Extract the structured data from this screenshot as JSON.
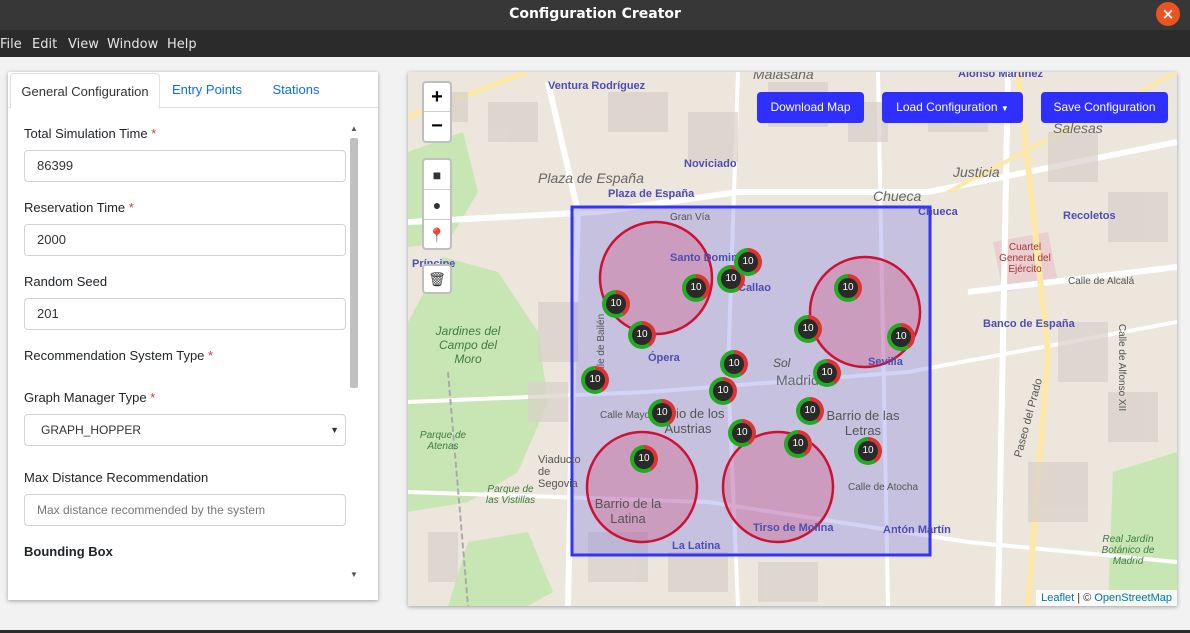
{
  "window": {
    "title": "Configuration Creator",
    "close_icon": "close-icon"
  },
  "menu": [
    "File",
    "Edit",
    "View",
    "Window",
    "Help"
  ],
  "tabs": [
    "General Configuration",
    "Entry Points",
    "Stations"
  ],
  "form": {
    "total_simulation_time": {
      "label": "Total Simulation Time",
      "required": "*",
      "value": "86399"
    },
    "reservation_time": {
      "label": "Reservation Time",
      "required": "*",
      "value": "2000"
    },
    "random_seed": {
      "label": "Random Seed",
      "value": "201"
    },
    "recommendation_system_type": {
      "label": "Recommendation System Type",
      "required": "*"
    },
    "graph_manager_type": {
      "label": "Graph Manager Type",
      "required": "*",
      "value": "GRAPH_HOPPER"
    },
    "max_distance_recommendation": {
      "label": "Max Distance Recommendation",
      "placeholder": "Max distance recommended by the system"
    },
    "bounding_box": {
      "label": "Bounding Box"
    }
  },
  "map": {
    "zoom_in": "+",
    "zoom_out": "−",
    "buttons": {
      "download": "Download Map",
      "load": "Load Configuration",
      "save": "Save Configuration"
    },
    "attribution_leaflet": "Leaflet",
    "attribution_sep": " | © ",
    "attribution_osm": "OpenStreetMap",
    "cluster_label": "10",
    "labels": {
      "malasana": "Malasaña",
      "ventura": "Ventura Rodríguez",
      "alonso_martinez": "Alonso Martínez",
      "noviciado": "Noviciado",
      "plaza_espana": "Plaza de España",
      "plaza_espana_metro": "Plaza de España",
      "chueca_big": "Chueca",
      "chueca_metro": "Chueca",
      "justicia": "Justicia",
      "salesas": "Salesas",
      "recoletos": "Recoletos",
      "santo_domingo": "Santo Domingo",
      "callao": "Callao",
      "gran_via": "Gran Vía",
      "opera": "Ópera",
      "sol": "Sol",
      "madrid": "Madrid",
      "sevilla": "Sevilla",
      "barrio_austrias": "Barrio de los Austrias",
      "barrio_letras": "Barrio de las Letras",
      "barrio_latina": "Barrio de la Latina",
      "la_latina": "La Latina",
      "tirso": "Tirso de Molina",
      "anton_martin": "Antón Martín",
      "banco_espana": "Banco de España",
      "cuartel": "Cuartel General del Ejército",
      "jardines": "Jardines del Campo del Moro",
      "parque_atenas": "Parque de Atenas",
      "parque_vistillas": "Parque de las Vistillas",
      "viaducto": "Viaducto de Segovia",
      "principe": "Príncipe",
      "calle_mayor": "Calle Mayor",
      "calle_atocha": "Calle de Atocha",
      "calle_alcala": "Calle de Alcalá",
      "calle_bailen": "Calle de Bailén",
      "paseo_prado": "Paseo del Prado",
      "real_jardin": "Real Jardín Botánico de Madrid",
      "calle_alfonso": "Calle de Alfonso XII"
    }
  }
}
